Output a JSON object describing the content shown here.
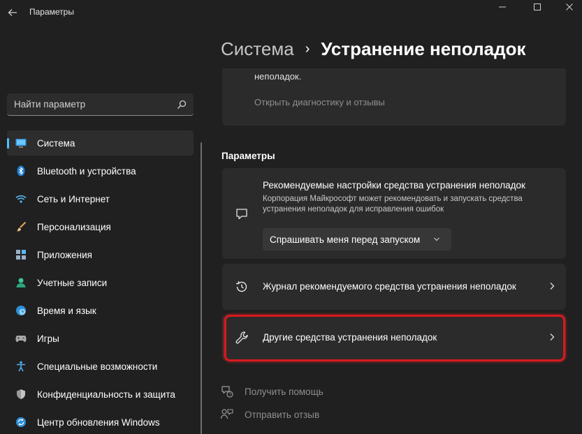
{
  "window": {
    "title": "Параметры"
  },
  "search": {
    "placeholder": "Найти параметр"
  },
  "sidebar": {
    "items": [
      {
        "label": "Система",
        "icon": "system-monitor-icon",
        "active": true
      },
      {
        "label": "Bluetooth и устройства",
        "icon": "bluetooth-icon"
      },
      {
        "label": "Сеть и Интернет",
        "icon": "wifi-icon"
      },
      {
        "label": "Персонализация",
        "icon": "brush-icon"
      },
      {
        "label": "Приложения",
        "icon": "apps-icon"
      },
      {
        "label": "Учетные записи",
        "icon": "account-icon"
      },
      {
        "label": "Время и язык",
        "icon": "globe-clock-icon"
      },
      {
        "label": "Игры",
        "icon": "gamepad-icon"
      },
      {
        "label": "Специальные возможности",
        "icon": "accessibility-icon"
      },
      {
        "label": "Конфиденциальность и защита",
        "icon": "shield-icon"
      },
      {
        "label": "Центр обновления Windows",
        "icon": "update-icon"
      }
    ]
  },
  "header": {
    "parent": "Система",
    "separator": "›",
    "current": "Устранение неполадок"
  },
  "top_card": {
    "partial_text": "неполадок.",
    "link": "Открыть диагностику и отзывы"
  },
  "section": {
    "title": "Параметры"
  },
  "recommended": {
    "title": "Рекомендуемые настройки средства устранения неполадок",
    "description": "Корпорация Майкрософт может рекомендовать и запускать средства устранения неполадок для исправления ошибок",
    "dropdown_value": "Спрашивать меня перед запуском"
  },
  "history": {
    "label": "Журнал рекомендуемого средства устранения неполадок"
  },
  "other": {
    "label": "Другие средства устранения неполадок"
  },
  "footer": {
    "help": "Получить помощь",
    "feedback": "Отправить отзыв"
  },
  "colors": {
    "accent": "#4cc2ff",
    "highlight": "#d7191f",
    "background": "#202020",
    "card": "#2b2b2b"
  }
}
